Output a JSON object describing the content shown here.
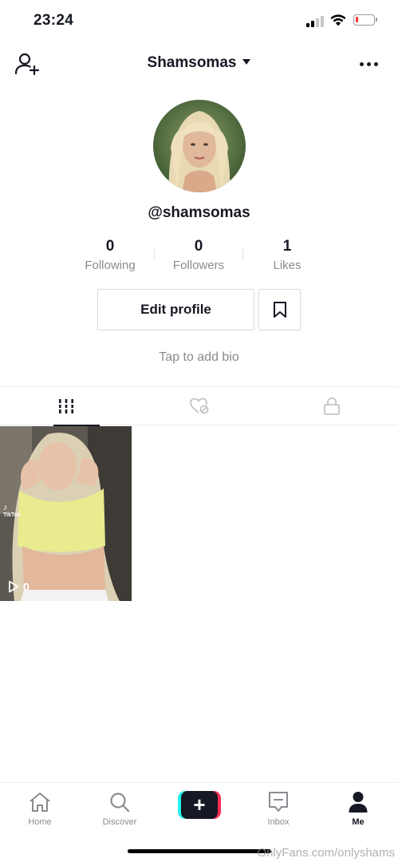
{
  "status_bar": {
    "time": "23:24",
    "battery_color": "#ff3b30"
  },
  "header": {
    "title": "Shamsomas",
    "add_user_icon": "person-add-icon",
    "more_icon": "ellipsis-icon"
  },
  "profile": {
    "username": "@shamsomas",
    "stats": [
      {
        "value": "0",
        "label": "Following"
      },
      {
        "value": "0",
        "label": "Followers"
      },
      {
        "value": "1",
        "label": "Likes"
      }
    ],
    "edit_button": "Edit profile",
    "bio_prompt": "Tap to add bio"
  },
  "tabs": [
    {
      "icon": "grid-icon",
      "active": true
    },
    {
      "icon": "liked-hidden-icon",
      "active": false
    },
    {
      "icon": "lock-icon",
      "active": false
    }
  ],
  "videos": [
    {
      "views": "0",
      "overlay_brand": "TikTok"
    }
  ],
  "bottom_nav": [
    {
      "label": "Home",
      "icon": "home-icon",
      "active": false
    },
    {
      "label": "Discover",
      "icon": "search-icon",
      "active": false
    },
    {
      "label": "",
      "icon": "plus-icon",
      "active": false
    },
    {
      "label": "Inbox",
      "icon": "inbox-icon",
      "active": false
    },
    {
      "label": "Me",
      "icon": "person-icon",
      "active": true
    }
  ],
  "watermark": "OnlyFans.com/onlyshams",
  "colors": {
    "accent_cyan": "#25f4ee",
    "accent_red": "#fe2c55",
    "text_primary": "#161823",
    "text_secondary": "#8a8b91"
  }
}
